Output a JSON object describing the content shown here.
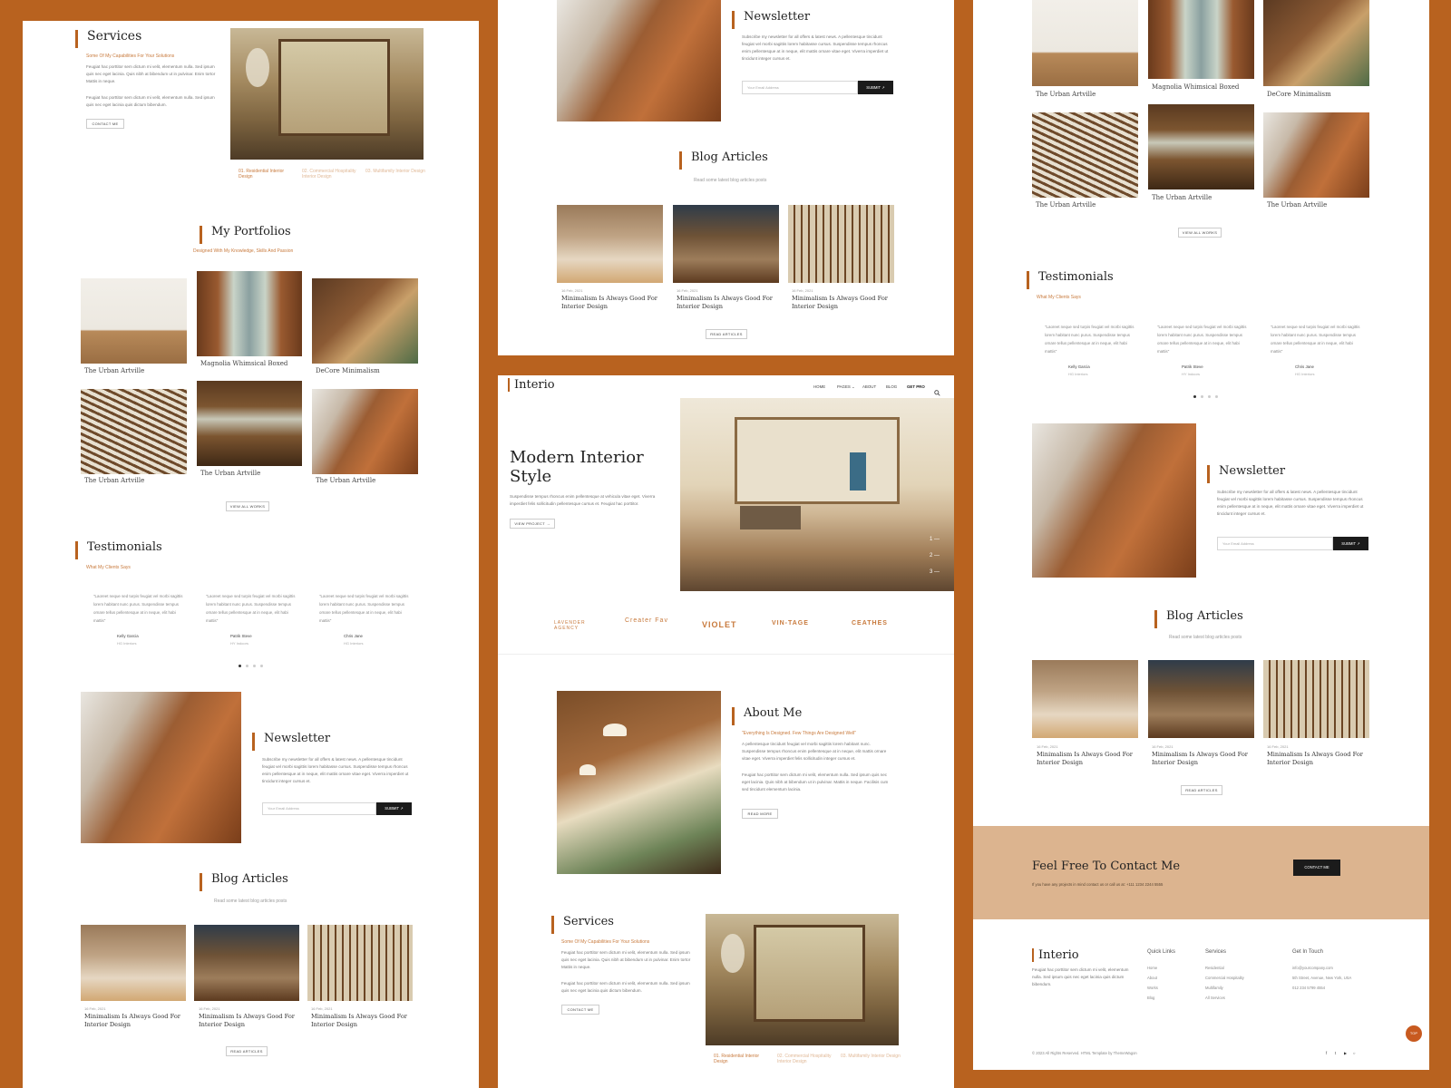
{
  "colors": {
    "accent": "#b8621f",
    "dark": "#1b1b1b",
    "contact_band": "#dcb48f"
  },
  "services": {
    "title": "Services",
    "subtitle": "Some Of My Capabilities For Your Solutions",
    "p1": "Feugiat hac porttitor sem dictum mi velit, elementum nulla. Sed ipsum quis nec eget lacinia. Quis nibh at bibendum ut in pulvinar. Enim tortor Mattis in neque.",
    "p2": "Feugiat hac porttitor sem dictum mi velit, elementum nulla. Sed ipsum quis nec eget lacinia quis dictum bibendum.",
    "button": "CONTACT ME",
    "features": [
      "01. Residential Interior Design",
      "02. Commercial Hospitality Interior Design",
      "03. Multifamily Interior Design"
    ]
  },
  "portfolios": {
    "title": "My Portfolios",
    "subtitle": "Designed With My Knowledge, Skills And Passion",
    "items": [
      "The Urban Artville",
      "Magnolia Whimsical Boxed",
      "DeCore Minimalism",
      "The Urban Artville",
      "The Urban Artville",
      "The Urban Artville"
    ],
    "button": "VIEW ALL WORKS"
  },
  "testimonials": {
    "title": "Testimonials",
    "subtitle": "What My Clients Says",
    "quote": "\"Laoreet neque sed turpis feugiat vel morbi sagittis lorem habitant nunc purus. Suspendisse tempus ornare tellus pellentesque at in neque, elit habi mattis\"",
    "people": [
      {
        "name": "Kelly Garcia",
        "role": "HG Interiors"
      },
      {
        "name": "Patrik Steve",
        "role": "HY Indoors"
      },
      {
        "name": "Chris Jane",
        "role": "HG Interiors"
      }
    ]
  },
  "newsletter": {
    "title": "Newsletter",
    "text": "Subscribe my newsletter for all offers & latest news. A pellentesque tincidunt feugiat vel morbi sagittis lorem habitasse cursus. Suspendisse tempus rhoncus enim pellentesque at in neque, elit mattis ornare vitae eget. Viverra imperdiet ut tincidunt integer cursus et.",
    "placeholder": "Your Email Address",
    "button": "SUBMIT ↗"
  },
  "blog": {
    "title": "Blog Articles",
    "subtitle": "Read some latest blog articles posts",
    "date": "16 Feb, 2021",
    "post_title": "Minimalism Is Always Good For Interior Design",
    "button": "READ ARTICLES"
  },
  "header": {
    "brand": "Interio",
    "nav": [
      "HOME",
      "PAGES ⌄",
      "ABOUT",
      "BLOG",
      "GET PRO"
    ],
    "search_icon": "search-icon"
  },
  "hero": {
    "title": "Modern Interior Style",
    "text": "Suspendisse tempus rhoncus enim pellentesque at vehicula vitae eget. Viverra imperdiet felis sollicitudin pellentesque cursus et. Feugiat hac porttitor.",
    "button": "VIEW PROJECT →",
    "slides": [
      "1 —",
      "2 —",
      "3 —"
    ]
  },
  "logos": [
    "LAVENDER AGENCY",
    "Creater Fav",
    "VIOLET",
    "VIN-TAGE",
    "CEATHES"
  ],
  "about": {
    "title": "About Me",
    "subtitle": "\"Everything Is Designed. Few Things Are Designed Well\"",
    "p1": "A pellentesque tincidunt feugiat vel morbi sagittis lorem habitant nunc. Suspendisse tempus rhoncus enim pellentesque at in neque, elit mattis ornare vitae eget. Viverra imperdiet felis sollicitudin integer cursus et.",
    "p2": "Feugiat hac porttitor sem dictum mi velit, elementum nulla. Sed ipsum quis nec eget lacinia. Quis nibh at bibendum ut in pulvinar. Mattis in neque. Facilisis cum sed tincidunt elementum lacinia.",
    "button": "READ MORE"
  },
  "contact": {
    "title": "Feel Free To Contact Me",
    "text": "If you have any projects in mind contact us or call us at: +111 1234 2244 5555",
    "button": "CONTACT ME"
  },
  "footer": {
    "brand": "Interio",
    "about": "Feugiat hac porttitor sem dictum mi velit, elementum nulla. Sed ipsum quis nec eget lacinia quis dictum bibendum.",
    "quick_links_title": "Quick Links",
    "quick_links": [
      "Home",
      "About",
      "Works",
      "Blog"
    ],
    "services_title": "Services",
    "services": [
      "Residential",
      "Commercial Hospitality",
      "Multifamily",
      "All Services"
    ],
    "contact_title": "Get In Touch",
    "contact": [
      "info@yourcompany.com",
      "5th Street, Avenue, New York, USA",
      "012 234 5799 4554"
    ],
    "copyright": "© 2023 All Rights Reserved. HTML Template by ThemeWagon",
    "social": [
      "f",
      "t",
      "▶",
      "○"
    ],
    "top_button": "TOP"
  }
}
